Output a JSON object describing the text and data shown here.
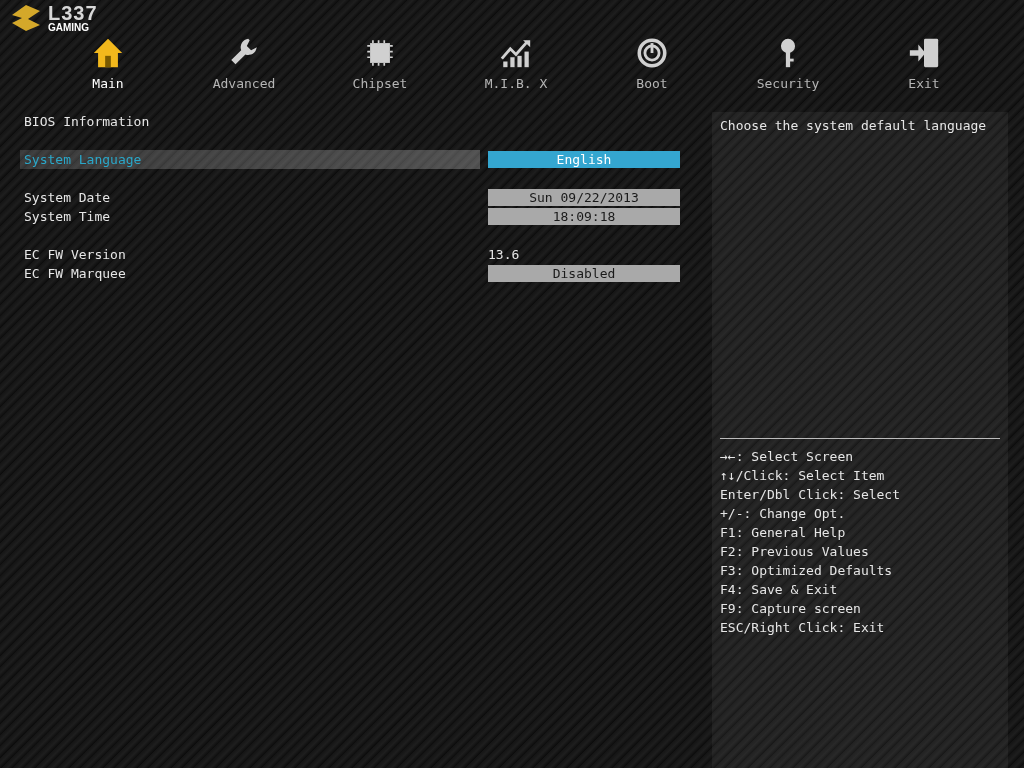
{
  "logo": {
    "mark": "L337",
    "sub": "GAMING"
  },
  "tabs": [
    {
      "label": "Main",
      "selected": true
    },
    {
      "label": "Advanced",
      "selected": false
    },
    {
      "label": "Chipset",
      "selected": false
    },
    {
      "label": "M.I.B. X",
      "selected": false
    },
    {
      "label": "Boot",
      "selected": false
    },
    {
      "label": "Security",
      "selected": false
    },
    {
      "label": "Exit",
      "selected": false
    }
  ],
  "setting_groups": [
    [
      {
        "kind": "header",
        "label": "BIOS Information"
      }
    ],
    [
      {
        "kind": "option",
        "label": "System Language",
        "value": "English",
        "selected": true
      }
    ],
    [
      {
        "kind": "option",
        "label": "System Date",
        "value": "Sun 09/22/2013",
        "selected": false
      },
      {
        "kind": "option",
        "label": "System Time",
        "value": "18:09:18",
        "selected": false
      }
    ],
    [
      {
        "kind": "info",
        "label": "EC FW Version",
        "value": "13.6",
        "selected": false
      },
      {
        "kind": "option",
        "label": "EC FW Marquee",
        "value": "Disabled",
        "selected": false
      }
    ]
  ],
  "help_text": "Choose the system default language",
  "key_help": [
    "→←: Select Screen",
    "↑↓/Click: Select Item",
    "Enter/Dbl Click: Select",
    "+/-: Change Opt.",
    "F1: General Help",
    "F2: Previous Values",
    "F3: Optimized Defaults",
    "F4: Save & Exit",
    "F9: Capture screen",
    "ESC/Right Click: Exit"
  ]
}
